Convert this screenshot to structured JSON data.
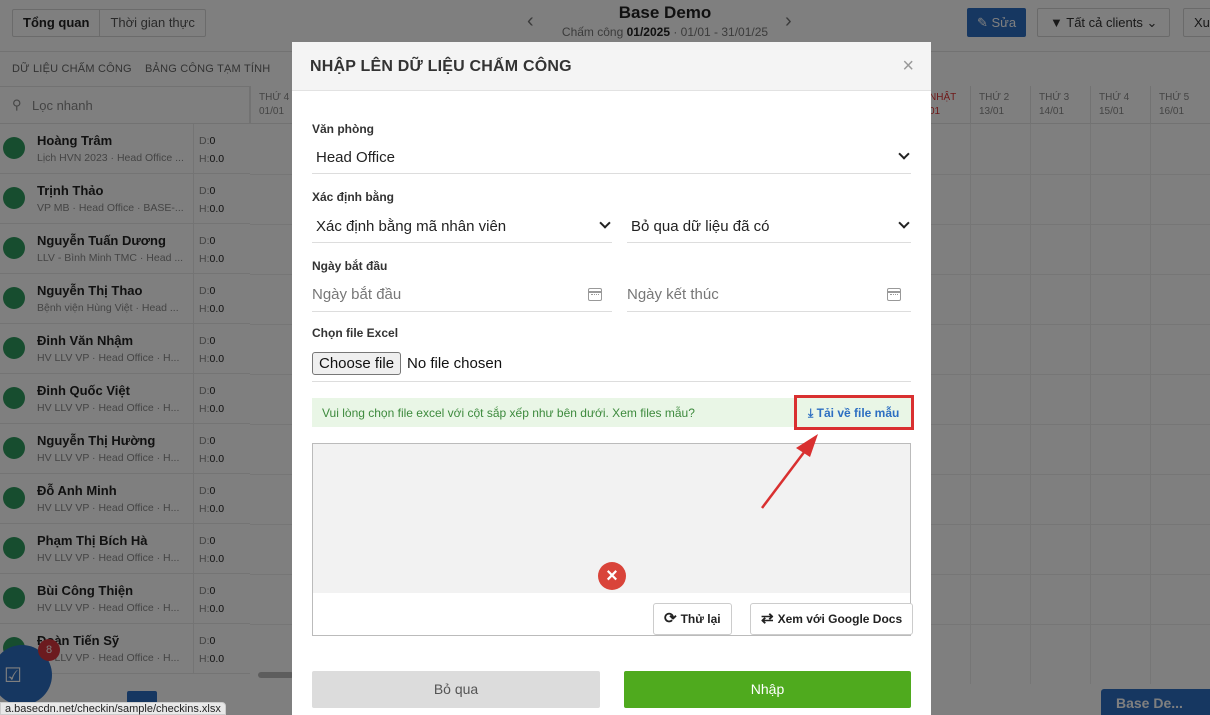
{
  "app": {
    "view_tabs": [
      "Tổng quan",
      "Thời gian thực"
    ],
    "title": "Base Demo",
    "period_prefix": "Chấm công ",
    "period_month": "01/2025",
    "period_range": " · 01/01 - 31/01/25",
    "edit_label": "Sửa",
    "clients_label": "Tất cả clients",
    "export_label": "Xuấ",
    "subtabs": [
      "Dữ liệu chấm công",
      "Bảng công tạm tính"
    ],
    "search_placeholder": "Lọc nhanh",
    "days": [
      {
        "name": "THỨ 4",
        "date": "01/01"
      },
      {
        "name": "NHẬT",
        "date": "01"
      },
      {
        "name": "THỨ 2",
        "date": "13/01"
      },
      {
        "name": "THỨ 3",
        "date": "14/01"
      },
      {
        "name": "THỨ 4",
        "date": "15/01"
      },
      {
        "name": "THỨ 5",
        "date": "16/01"
      }
    ],
    "employees": [
      {
        "name": "Hoàng Trâm",
        "sub": "Lịch HVN 2023 · Head Office ...",
        "d": "0",
        "h": "0.0"
      },
      {
        "name": "Trịnh Thảo",
        "sub": "VP MB · Head Office · BASE-...",
        "d": "0",
        "h": "0.0"
      },
      {
        "name": "Nguyễn Tuấn Dương",
        "sub": "LLV - Bình Minh TMC · Head ...",
        "d": "0",
        "h": "0.0"
      },
      {
        "name": "Nguyễn Thị Thao",
        "sub": "Bệnh viện Hùng Việt · Head ...",
        "d": "0",
        "h": "0.0"
      },
      {
        "name": "Đinh Văn Nhậm",
        "sub": "HV LLV VP · Head Office · H...",
        "d": "0",
        "h": "0.0"
      },
      {
        "name": "Đinh Quốc Việt",
        "sub": "HV LLV VP · Head Office · H...",
        "d": "0",
        "h": "0.0"
      },
      {
        "name": "Nguyễn Thị Hường",
        "sub": "HV LLV VP · Head Office · H...",
        "d": "0",
        "h": "0.0"
      },
      {
        "name": "Đỗ Anh Minh",
        "sub": "HV LLV VP · Head Office · H...",
        "d": "0",
        "h": "0.0"
      },
      {
        "name": "Phạm Thị Bích Hà",
        "sub": "HV LLV VP · Head Office · H...",
        "d": "0",
        "h": "0.0"
      },
      {
        "name": "Bùi Công Thiện",
        "sub": "HV LLV VP · Head Office · H...",
        "d": "0",
        "h": "0.0"
      },
      {
        "name": "Đoàn Tiến Sỹ",
        "sub": "HV LLV VP · Head Office · H...",
        "d": "0",
        "h": "0.0"
      }
    ],
    "d_prefix": "D:",
    "h_prefix": "H:",
    "badge_count": "8",
    "status_url": "a.basecdn.net/checkin/sample/checkins.xlsx",
    "workspace_label": "Base De..."
  },
  "modal": {
    "title": "NHẬP LÊN DỮ LIỆU CHẤM CÔNG",
    "office_label": "Văn phòng",
    "office_value": "Head Office",
    "identify_label": "Xác định bằng",
    "identify_value": "Xác định bằng mã nhân viên",
    "duplicate_value": "Bỏ qua dữ liệu đã có",
    "start_date_label": "Ngày bắt đầu",
    "start_date_placeholder": "Ngày bắt đầu",
    "end_date_placeholder": "Ngày kết thúc",
    "file_label": "Chọn file Excel",
    "choose_file": "Choose file",
    "no_file": "No file chosen",
    "note_text": "Vui lòng chọn file excel với cột sắp xếp như bên dưới. Xem files mẫu?",
    "download_sample": "Tải về file mẫu",
    "retry_label": "Thử lại",
    "gdocs_label": "Xem với Google Docs",
    "cancel_label": "Bỏ qua",
    "submit_label": "Nhập"
  },
  "colors": {
    "primary": "#2d6fc2",
    "submit": "#4faa1e",
    "highlight": "#d93030",
    "error": "#d9443a"
  }
}
